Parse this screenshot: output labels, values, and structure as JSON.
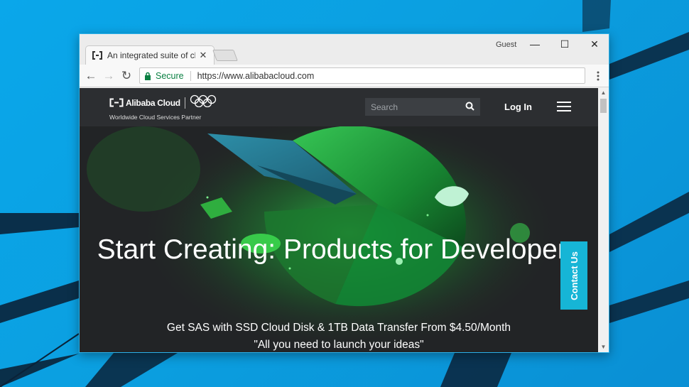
{
  "browser": {
    "tab_title": "An integrated suite of clo",
    "guest_label": "Guest",
    "minimize": "—",
    "maximize": "☐",
    "close": "✕",
    "secure_label": "Secure",
    "url": "https://www.alibabacloud.com"
  },
  "site": {
    "logo_text": "Alibaba Cloud",
    "logo_tagline": "Worldwide Cloud Services Partner",
    "search_placeholder": "Search",
    "login_label": "Log In",
    "hero_title": "Start Creating: Products for Developers",
    "hero_subtitle_1": "Get SAS with SSD Cloud Disk & 1TB Data Transfer From $4.50/Month",
    "hero_subtitle_2": "\"All you need to launch your ideas\"",
    "contact_label": "Contact Us"
  },
  "icons": {
    "favicon": "alibaba-bracket-icon",
    "lock": "lock-icon",
    "search": "magnifier-icon"
  },
  "colors": {
    "accent": "#16b5d6",
    "secure": "#0b8043",
    "desktop": "#0aa7ea"
  }
}
